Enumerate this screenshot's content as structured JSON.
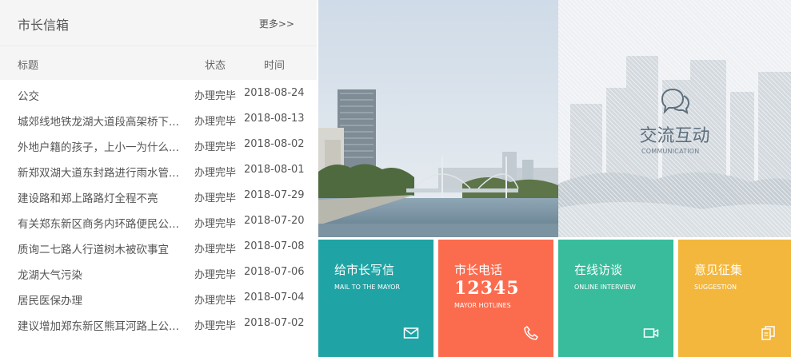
{
  "mailbox": {
    "title": "市长信箱",
    "more": "更多>>",
    "columns": {
      "title": "标题",
      "status": "状态",
      "time": "时间"
    },
    "rows": [
      {
        "title": "公交",
        "status": "办理完毕",
        "date": "2018-08-24"
      },
      {
        "title": "城郊线地铁龙湖大道段高架桥下...",
        "status": "办理完毕",
        "date": "2018-08-13"
      },
      {
        "title": "外地户籍的孩子，上小一为什么...",
        "status": "办理完毕",
        "date": "2018-08-02"
      },
      {
        "title": "新郑双湖大道东封路进行雨水管...",
        "status": "办理完毕",
        "date": "2018-08-01"
      },
      {
        "title": "建设路和郑上路路灯全程不亮",
        "status": "办理完毕",
        "date": "2018-07-29"
      },
      {
        "title": "有关郑东新区商务内环路便民公...",
        "status": "办理完毕",
        "date": "2018-07-20"
      },
      {
        "title": "质询二七路人行道树木被砍事宜",
        "status": "办理完毕",
        "date": "2018-07-08"
      },
      {
        "title": "龙湖大气污染",
        "status": "办理完毕",
        "date": "2018-07-06"
      },
      {
        "title": "居民医保办理",
        "status": "办理完毕",
        "date": "2018-07-04"
      },
      {
        "title": "建议增加郑东新区熊耳河路上公...",
        "status": "办理完毕",
        "date": "2018-07-02"
      }
    ]
  },
  "communication": {
    "title": "交流互动",
    "subtitle": "COMMUNICATION",
    "icon": "chat-bubbles-icon"
  },
  "tiles": {
    "mail": {
      "cn": "给市长写信",
      "en": "MAIL TO THE MAYOR",
      "icon": "envelope-icon",
      "color": "#20a3a4"
    },
    "phone": {
      "cn": "市长电话",
      "number": "12345",
      "en": "MAYOR HOTLINES",
      "icon": "phone-icon",
      "color": "#fb6c4f"
    },
    "online": {
      "cn": "在线访谈",
      "en": "ONLINE INTERVIEW",
      "icon": "video-camera-icon",
      "color": "#38bc9c"
    },
    "suggest": {
      "cn": "意见征集",
      "en": "SUGGESTION",
      "icon": "documents-icon",
      "color": "#f3b73d"
    }
  }
}
